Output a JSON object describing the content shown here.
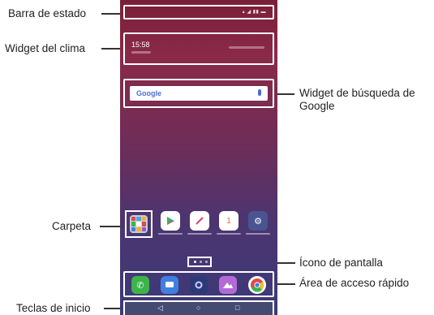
{
  "labels": {
    "status_bar": "Barra de estado",
    "weather_widget": "Widget del clima",
    "google_search_widget": "Widget de búsqueda de Google",
    "folder": "Carpeta",
    "screen_icon": "Ícono de pantalla",
    "quick_access": "Área de acceso rápido",
    "home_keys": "Teclas de inicio"
  },
  "phone": {
    "time": "15:58",
    "search_brand": "Google",
    "home_keys": {
      "back": "◁",
      "home": "○",
      "recents": "□"
    }
  },
  "colors": {
    "wallpaper_top": "#7a1f3a",
    "wallpaper_bottom": "#3b3a78",
    "phone_app_green": "#3db34a",
    "messages_blue": "#3f7fe0",
    "camera_navy": "#2e3a78",
    "gallery_purple": "#b46ad6"
  },
  "icons": {
    "home_apps": [
      "folder-icon",
      "play-store-icon",
      "quickmemo-icon",
      "calendar-icon",
      "settings-icon"
    ],
    "quick_access": [
      "phone-icon",
      "messages-icon",
      "camera-icon",
      "gallery-icon",
      "chrome-icon"
    ]
  }
}
